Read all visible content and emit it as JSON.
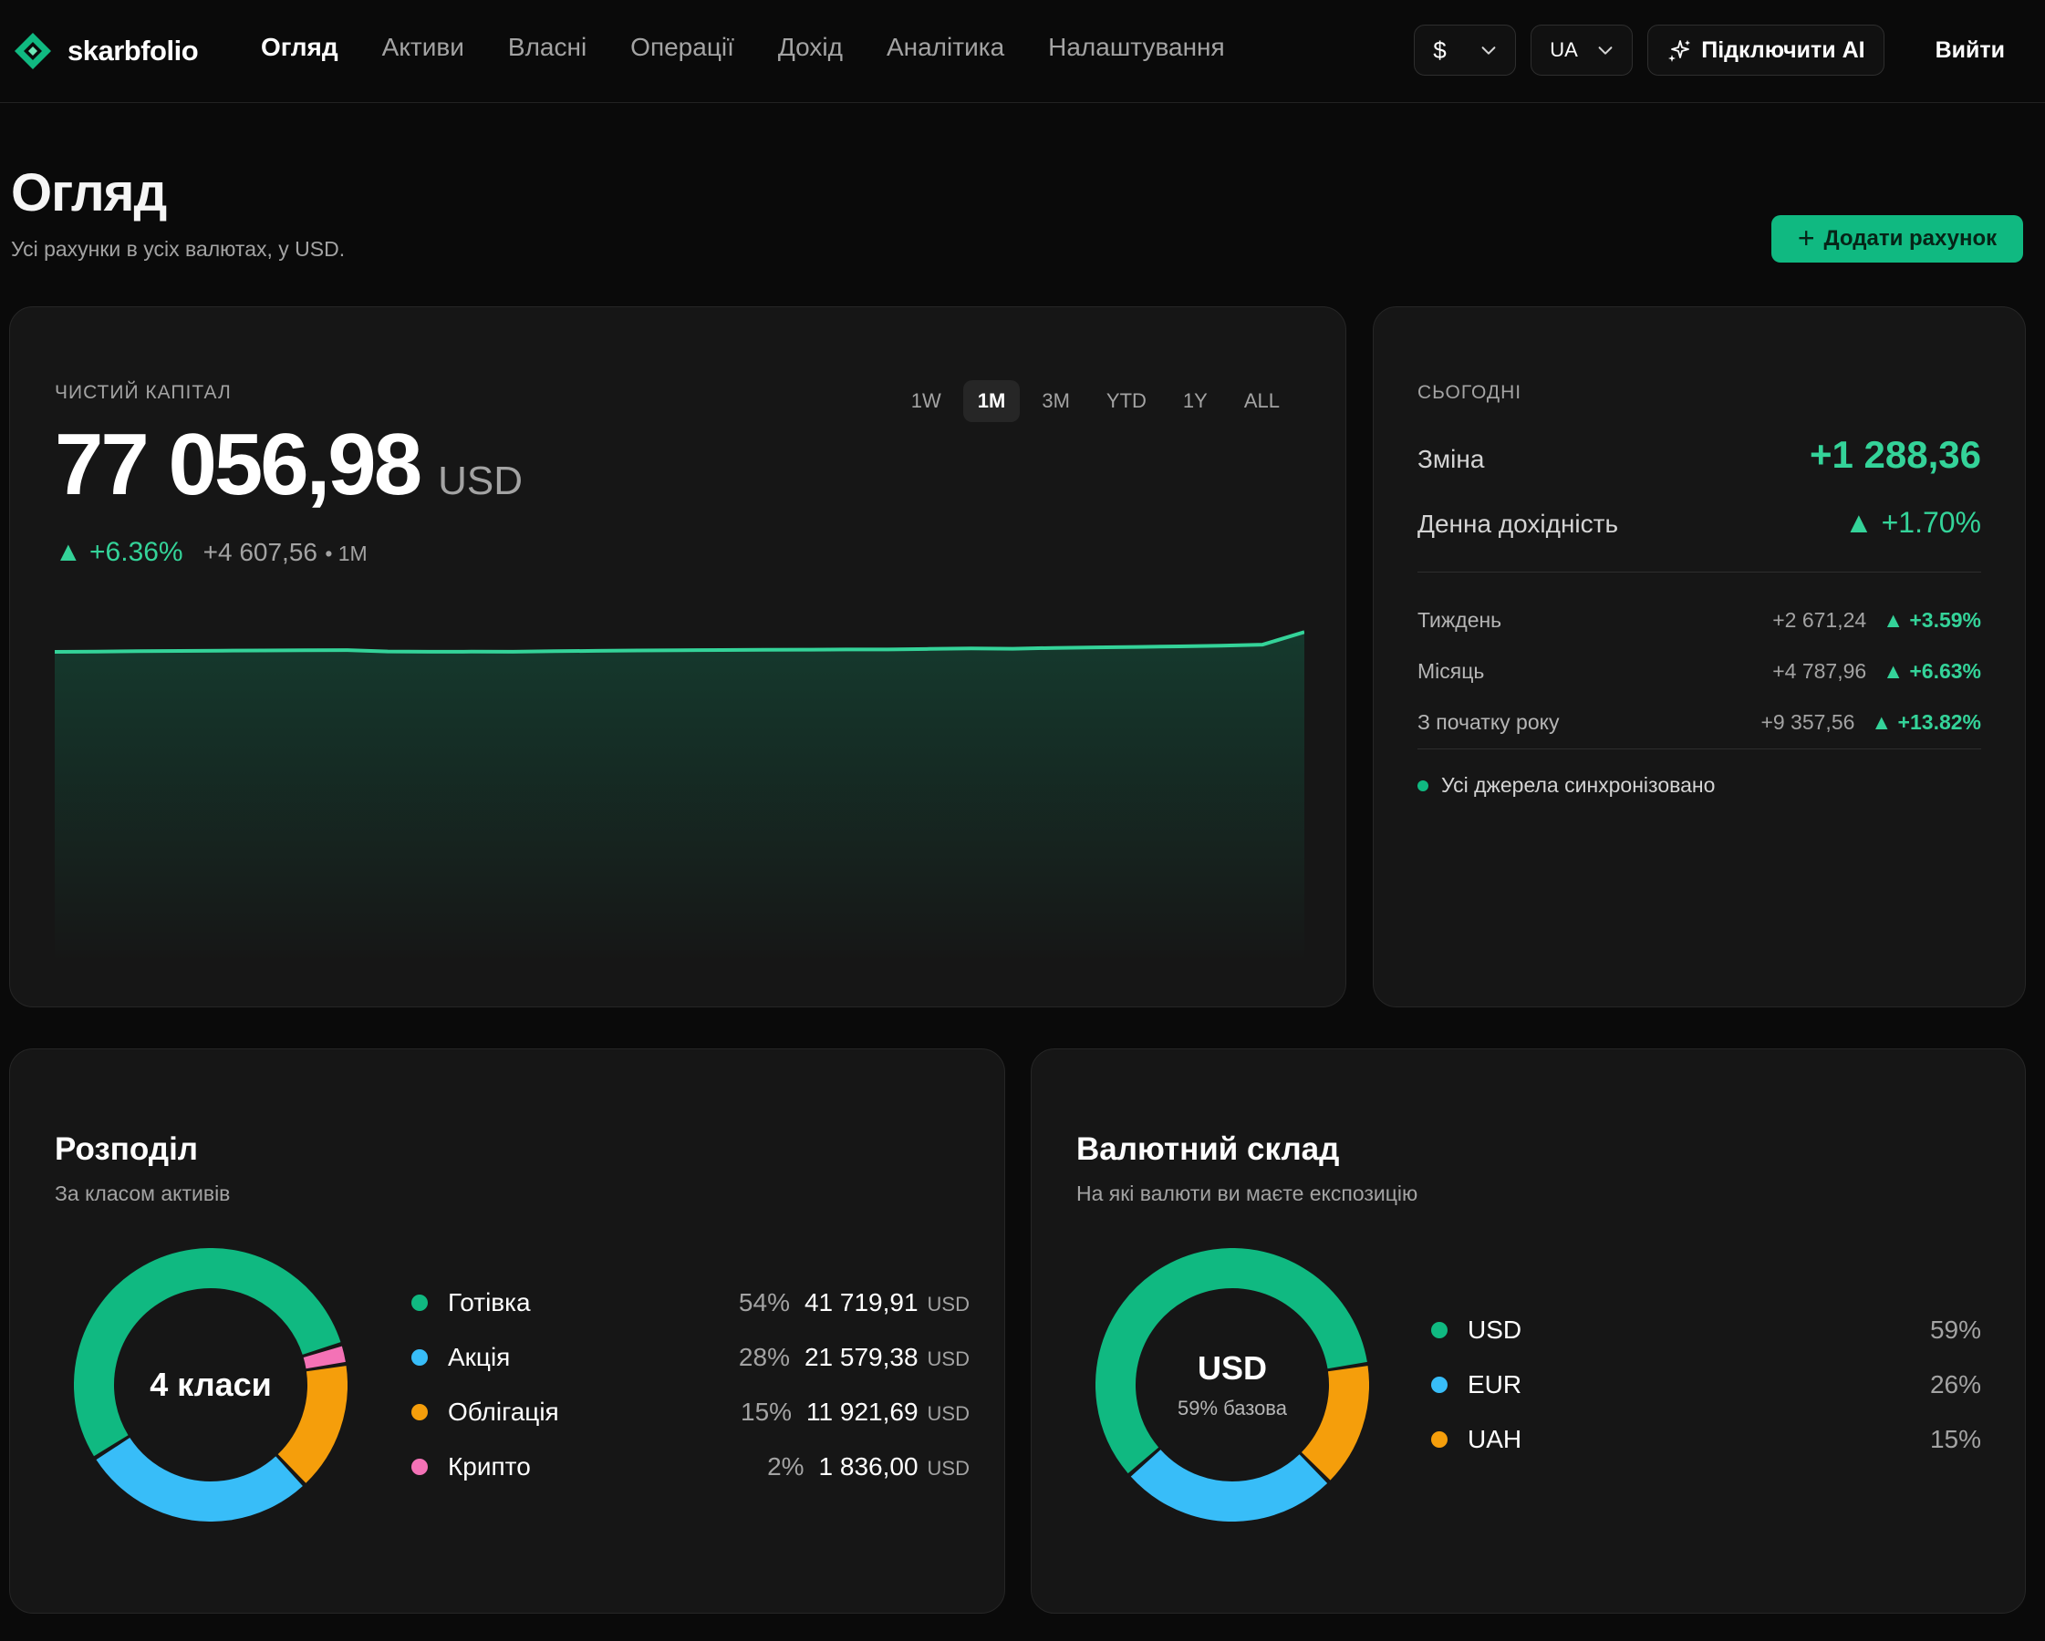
{
  "brand": {
    "name": "skarbfolio",
    "accent": "#10b981"
  },
  "nav": {
    "items": [
      "Огляд",
      "Активи",
      "Власні",
      "Операції",
      "Дохід",
      "Аналітика",
      "Налаштування"
    ],
    "active_index": 0
  },
  "topbar": {
    "currency": "$",
    "language": "UA",
    "ai_button": "Підключити AI",
    "logout": "Вийти"
  },
  "header": {
    "title": "Огляд",
    "subtitle": "Усі рахунки в усіх валютах, у USD.",
    "add_button": "Додати рахунок"
  },
  "net_worth": {
    "label": "ЧИСТИЙ КАПІТАЛ",
    "value": "77 056,98",
    "unit": "USD",
    "change_pct": "▲ +6.36%",
    "change_abs": "+4 607,56",
    "change_period": "• 1M",
    "ranges": [
      "1W",
      "1M",
      "3M",
      "YTD",
      "1Y",
      "ALL"
    ],
    "active_range": "1M"
  },
  "chart_data": {
    "type": "area",
    "series": [
      {
        "values": [
          72449.42,
          72520.1,
          72590.3,
          72655.8,
          72720.4,
          72760.9,
          72800.5,
          72860.2,
          72540.6,
          72480.3,
          72500.7,
          72470.9,
          72600.1,
          72690.5,
          72760.3,
          72830.6,
          72870.2,
          72910.8,
          72960.4,
          73010.7,
          72990.2,
          73120.6,
          73230.1,
          73180.5,
          73350.8,
          73480.3,
          73590.6,
          73720.9,
          73890.4,
          74120.7,
          77056.98
        ]
      }
    ],
    "xlabel": "",
    "ylabel": "",
    "grid": false
  },
  "today": {
    "label": "СЬОГОДНІ",
    "change_label": "Зміна",
    "change_value": "+1 288,36",
    "yield_label": "Денна дохідність",
    "yield_value": "▲ +1.70%",
    "periods": [
      {
        "label": "Тиждень",
        "abs": "+2 671,24",
        "pct": "▲ +3.59%"
      },
      {
        "label": "Місяць",
        "abs": "+4 787,96",
        "pct": "▲ +6.63%"
      },
      {
        "label": "З початку року",
        "abs": "+9 357,56",
        "pct": "▲ +13.82%"
      }
    ],
    "sync_text": "Усі джерела синхронізовано"
  },
  "allocation": {
    "title": "Розподіл",
    "subtitle": "За класом активів",
    "center": "4 класи",
    "items": [
      {
        "name": "Готівка",
        "pct": "54%",
        "amount": "41 719,91",
        "unit": "USD",
        "value": 54.14,
        "color": "#10b981"
      },
      {
        "name": "Акція",
        "pct": "28%",
        "amount": "21 579,38",
        "unit": "USD",
        "value": 28.0,
        "color": "#38bdf8"
      },
      {
        "name": "Облігація",
        "pct": "15%",
        "amount": "11 921,69",
        "unit": "USD",
        "value": 15.47,
        "color": "#f59e0b"
      },
      {
        "name": "Крипто",
        "pct": "2%",
        "amount": "1 836,00",
        "unit": "USD",
        "value": 2.38,
        "color": "#f472b6"
      }
    ]
  },
  "currency_mix": {
    "title": "Валютний склад",
    "subtitle": "На які валюти ви маєте експозицію",
    "center_main": "USD",
    "center_sub": "59% базова",
    "items": [
      {
        "name": "USD",
        "pct": "59%",
        "value": 59,
        "color": "#10b981"
      },
      {
        "name": "EUR",
        "pct": "26%",
        "value": 26,
        "color": "#38bdf8"
      },
      {
        "name": "UAH",
        "pct": "15%",
        "value": 15,
        "color": "#f59e0b"
      }
    ]
  }
}
